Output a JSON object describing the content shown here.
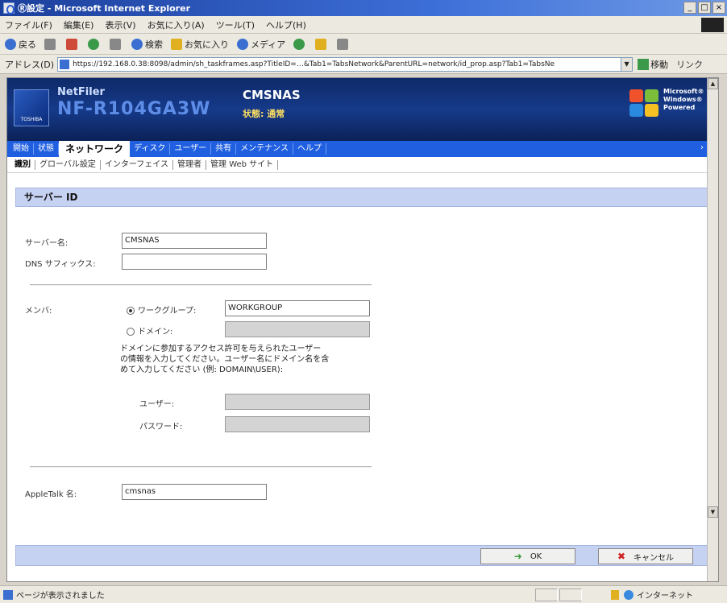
{
  "window": {
    "title": "Ⓡ設定 - Microsoft Internet Explorer",
    "min": "_",
    "max": "□",
    "close": "×"
  },
  "menu": [
    "ファイル(F)",
    "編集(E)",
    "表示(V)",
    "お気に入り(A)",
    "ツール(T)",
    "ヘルプ(H)"
  ],
  "toolbar": {
    "back": "戻る",
    "search": "検索",
    "favorites": "お気に入り",
    "media": "メディア"
  },
  "address": {
    "label": "アドレス(D)",
    "url": "https://192.168.0.38:8098/admin/sh_taskframes.asp?TitleID=…&Tab1=TabsNetwork&ParentURL=network/id_prop.asp?Tab1=TabsNe",
    "go": "移動",
    "links": "リンク"
  },
  "header": {
    "brand": "NetFiler",
    "model": "NF-R104GA3W",
    "hostname": "CMSNAS",
    "status": "状態: 通常",
    "logo_text": "TOSHIBA",
    "powered": [
      "Microsoft®",
      "Windows®",
      "Powered"
    ]
  },
  "tabs_main": [
    {
      "label": "開始",
      "active": false
    },
    {
      "label": "状態",
      "active": false
    },
    {
      "label": "ネットワーク",
      "active": true
    },
    {
      "label": "ディスク",
      "active": false
    },
    {
      "label": "ユーザー",
      "active": false
    },
    {
      "label": "共有",
      "active": false
    },
    {
      "label": "メンテナンス",
      "active": false
    },
    {
      "label": "ヘルプ",
      "active": false
    }
  ],
  "tabs_sub": [
    {
      "label": "識別",
      "active": true
    },
    {
      "label": "グローバル設定",
      "active": false
    },
    {
      "label": "インターフェイス",
      "active": false
    },
    {
      "label": "管理者",
      "active": false
    },
    {
      "label": "管理 Web サイト",
      "active": false
    }
  ],
  "section": {
    "title": "サーバー ID"
  },
  "form": {
    "server_name_label": "サーバー名:",
    "server_name_value": "CMSNAS",
    "dns_suffix_label": "DNS サフィックス:",
    "dns_suffix_value": "",
    "member_label": "メンバ:",
    "workgroup_label": "ワークグループ:",
    "workgroup_value": "WORKGROUP",
    "domain_label": "ドメイン:",
    "domain_value": "",
    "note_lines": [
      "ドメインに参加するアクセス許可を与えられたユーザー",
      "の情報を入力してください。ユーザー名にドメイン名を含",
      "めて入力してください (例: DOMAIN\\USER):"
    ],
    "user_label": "ユーザー:",
    "user_value": "",
    "password_label": "パスワード:",
    "password_value": "",
    "appletalk_label": "AppleTalk 名:",
    "appletalk_value": "cmsnas"
  },
  "buttons": {
    "ok": "OK",
    "cancel": "キャンセル"
  },
  "statusbar": {
    "text": "ページが表示されました",
    "zone": "インターネット"
  }
}
